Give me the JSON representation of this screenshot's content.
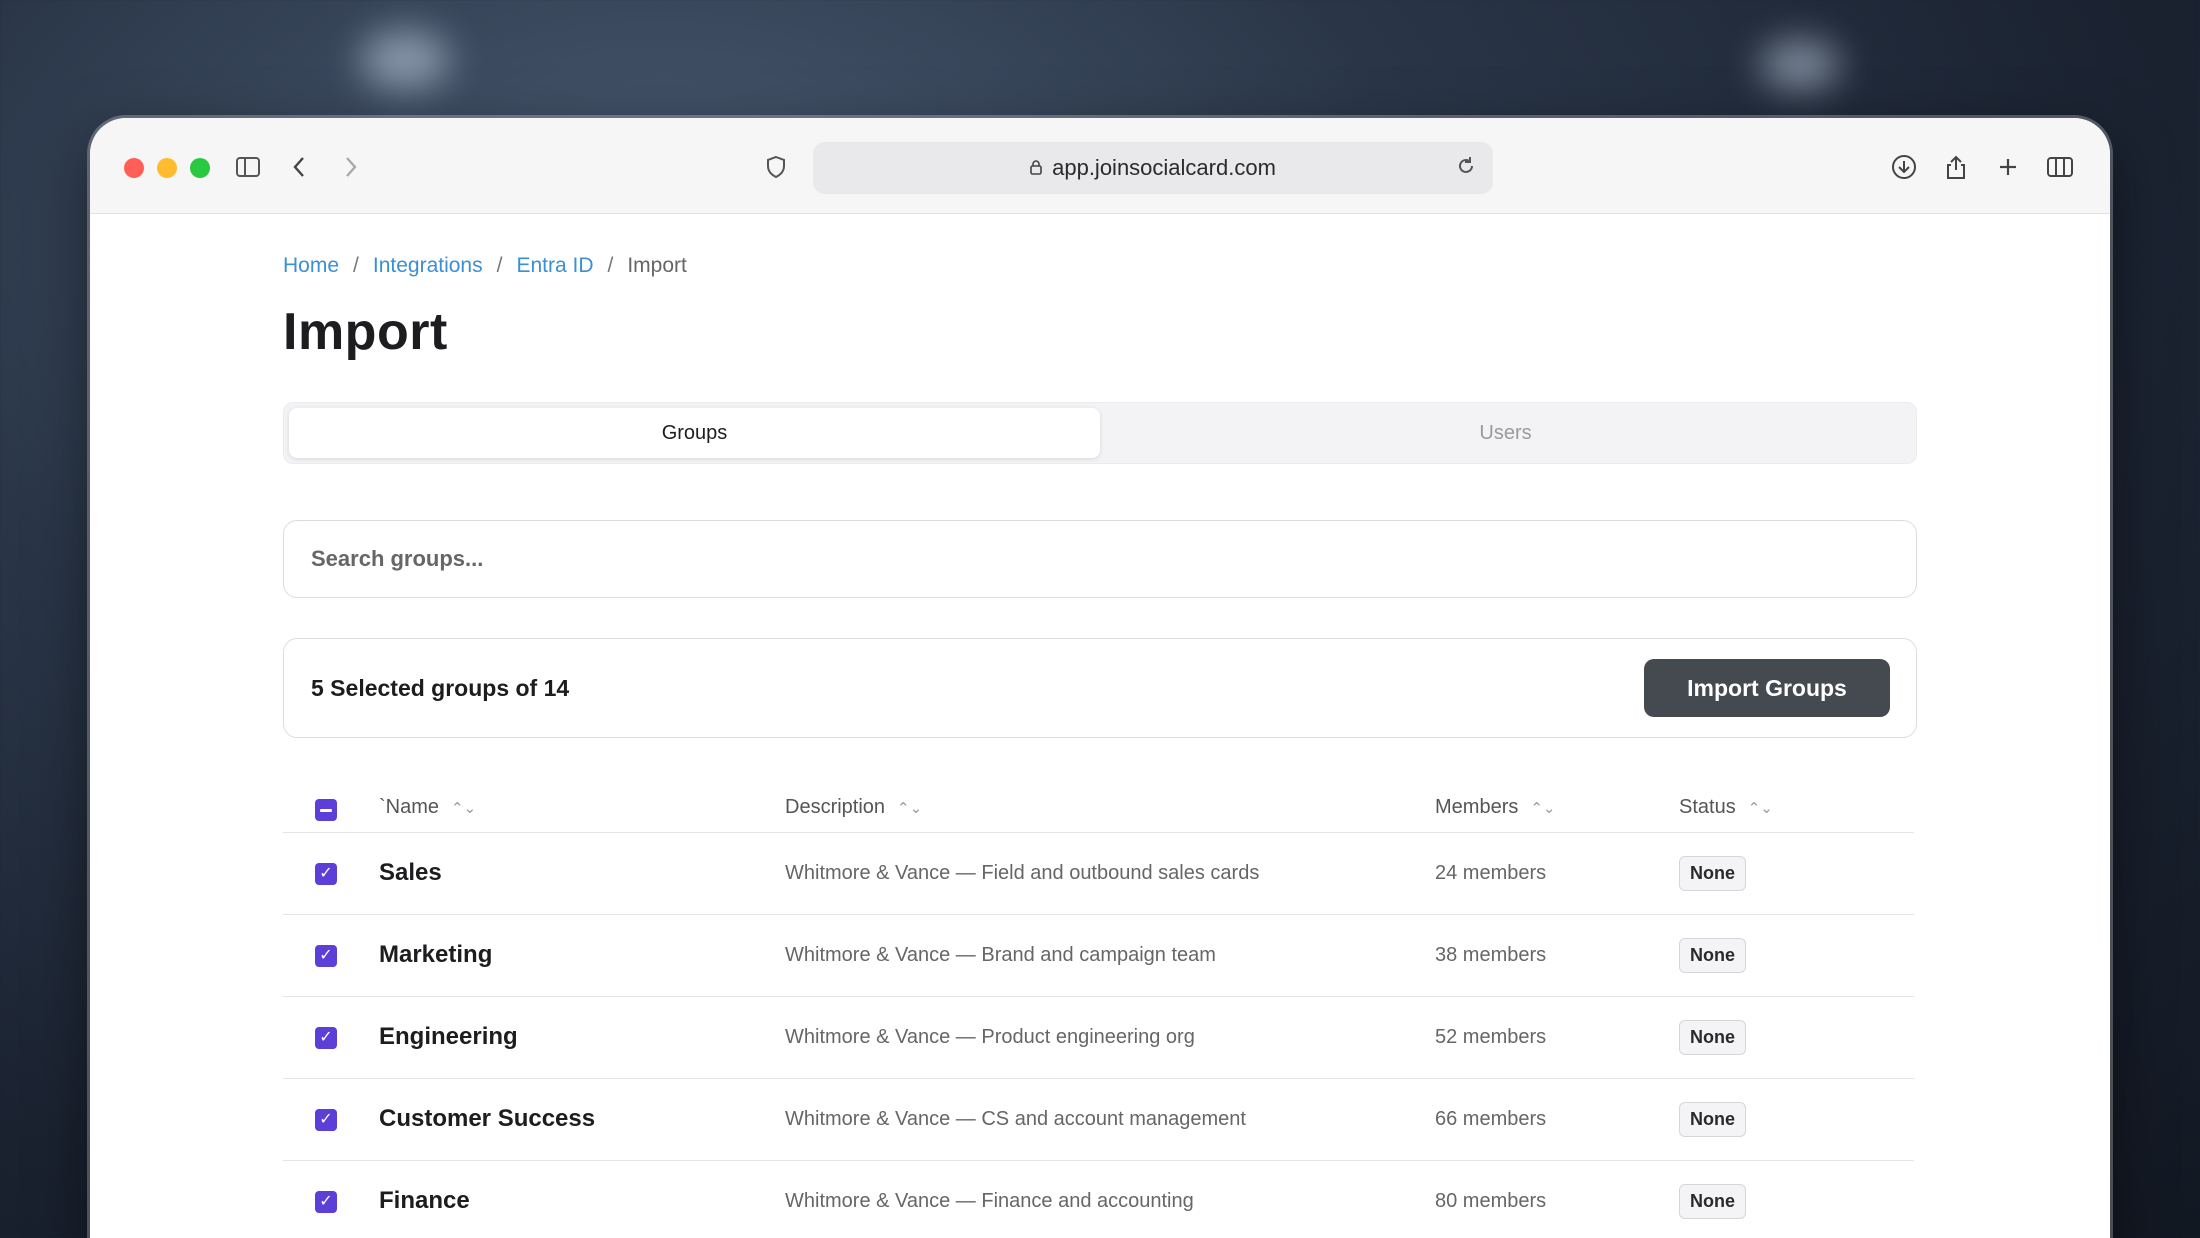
{
  "browser": {
    "url": "app.joinsocialcard.com"
  },
  "breadcrumb": {
    "items": [
      "Home",
      "Integrations",
      "Entra ID"
    ],
    "current": "Import",
    "separator": "/"
  },
  "page": {
    "title": "Import"
  },
  "tabs": [
    {
      "label": "Groups",
      "active": true
    },
    {
      "label": "Users",
      "active": false
    }
  ],
  "search": {
    "placeholder": "Search groups..."
  },
  "selection": {
    "summary": "5 Selected groups of 14",
    "import_label": "Import Groups"
  },
  "table": {
    "headers": {
      "name": "`Name",
      "description": "Description",
      "members": "Members",
      "status": "Status"
    },
    "rows": [
      {
        "name": "Sales",
        "description": "Whitmore & Vance — Field and outbound sales cards",
        "members": "24 members",
        "status": "None",
        "checked": true
      },
      {
        "name": "Marketing",
        "description": "Whitmore & Vance — Brand and campaign team",
        "members": "38 members",
        "status": "None",
        "checked": true
      },
      {
        "name": "Engineering",
        "description": "Whitmore & Vance — Product engineering org",
        "members": "52 members",
        "status": "None",
        "checked": true
      },
      {
        "name": "Customer Success",
        "description": "Whitmore & Vance — CS and account management",
        "members": "66 members",
        "status": "None",
        "checked": true
      },
      {
        "name": "Finance",
        "description": "Whitmore & Vance — Finance and accounting",
        "members": "80 members",
        "status": "None",
        "checked": true
      }
    ]
  },
  "colors": {
    "checkbox": "#5b3fd6",
    "link": "#3b8fd6",
    "import_button": "#444a50"
  }
}
